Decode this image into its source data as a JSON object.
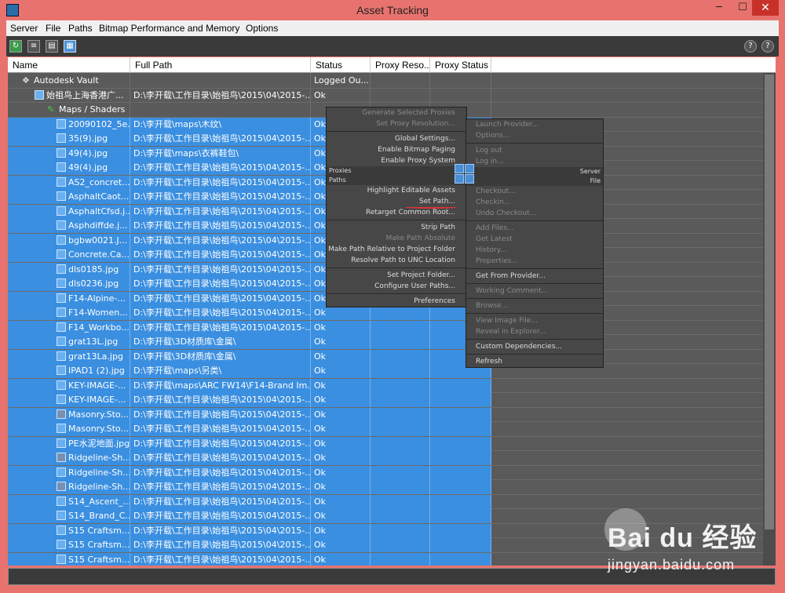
{
  "window": {
    "title": "Asset Tracking"
  },
  "menu": [
    "Server",
    "File",
    "Paths",
    "Bitmap Performance and Memory",
    "Options"
  ],
  "columns": [
    "Name",
    "Full Path",
    "Status",
    "Proxy Reso...",
    "Proxy Status"
  ],
  "rows": [
    {
      "name": "Autodesk Vault",
      "path": "",
      "status": "Logged Ou...",
      "icon": "vault-icon",
      "indent": 18,
      "sel": false
    },
    {
      "name": "始祖鸟上海香港广...",
      "path": "D:\\李开载\\工作目录\\始祖鸟\\2015\\04\\2015-...",
      "status": "Ok",
      "icon": "scene-icon",
      "indent": 34,
      "sel": false
    },
    {
      "name": "Maps / Shaders",
      "path": "",
      "status": "",
      "icon": "maps-icon",
      "indent": 50,
      "sel": false
    },
    {
      "name": "20090102_5e...",
      "path": "D:\\李开载\\maps\\木纹\\",
      "status": "Ok",
      "icon": "bitmap-icon",
      "indent": 62,
      "sel": true
    },
    {
      "name": "35(9).jpg",
      "path": "D:\\李开载\\工作目录\\始祖鸟\\2015\\04\\2015-...",
      "status": "Ok",
      "icon": "bitmap-icon",
      "indent": 62,
      "sel": true
    },
    {
      "name": "49(4).jpg",
      "path": "D:\\李开载\\maps\\衣裤鞋包\\",
      "status": "Ok",
      "icon": "bitmap-icon",
      "indent": 62,
      "sel": true
    },
    {
      "name": "49(4).jpg",
      "path": "D:\\李开载\\工作目录\\始祖鸟\\2015\\04\\2015-...",
      "status": "Ok",
      "icon": "bitmap-icon",
      "indent": 62,
      "sel": true
    },
    {
      "name": "AS2_concret...",
      "path": "D:\\李开载\\工作目录\\始祖鸟\\2015\\04\\2015-...",
      "status": "Ok",
      "icon": "bitmap-icon",
      "indent": 62,
      "sel": true
    },
    {
      "name": "AsphaltCaot...",
      "path": "D:\\李开载\\工作目录\\始祖鸟\\2015\\04\\2015-...",
      "status": "Ok",
      "icon": "bitmap-icon",
      "indent": 62,
      "sel": true
    },
    {
      "name": "AsphaltCfsd.j...",
      "path": "D:\\李开载\\工作目录\\始祖鸟\\2015\\04\\2015-...",
      "status": "Ok",
      "icon": "bitmap-icon",
      "indent": 62,
      "sel": true
    },
    {
      "name": "Asphdiffde.j...",
      "path": "D:\\李开载\\工作目录\\始祖鸟\\2015\\04\\2015-...",
      "status": "Ok",
      "icon": "bitmap-icon",
      "indent": 62,
      "sel": true
    },
    {
      "name": "bgbw0021.J...",
      "path": "D:\\李开载\\工作目录\\始祖鸟\\2015\\04\\2015-...",
      "status": "Ok",
      "icon": "bitmap-icon",
      "indent": 62,
      "sel": true
    },
    {
      "name": "Concrete.Ca...",
      "path": "D:\\李开载\\工作目录\\始祖鸟\\2015\\04\\2015-...",
      "status": "Ok",
      "icon": "bitmap-icon",
      "indent": 62,
      "sel": true
    },
    {
      "name": "dls0185.jpg",
      "path": "D:\\李开载\\工作目录\\始祖鸟\\2015\\04\\2015-...",
      "status": "Ok",
      "icon": "bitmap-icon",
      "indent": 62,
      "sel": true
    },
    {
      "name": "dls0236.jpg",
      "path": "D:\\李开载\\工作目录\\始祖鸟\\2015\\04\\2015-...",
      "status": "Ok",
      "icon": "bitmap-icon",
      "indent": 62,
      "sel": true
    },
    {
      "name": "F14-Alpine-...",
      "path": "D:\\李开载\\工作目录\\始祖鸟\\2015\\04\\2015-...",
      "status": "Ok",
      "icon": "bitmap-icon",
      "indent": 62,
      "sel": true
    },
    {
      "name": "F14-Women...",
      "path": "D:\\李开载\\工作目录\\始祖鸟\\2015\\04\\2015-...",
      "status": "Ok",
      "icon": "bitmap-icon",
      "indent": 62,
      "sel": true
    },
    {
      "name": "F14_Workbo...",
      "path": "D:\\李开载\\工作目录\\始祖鸟\\2015\\04\\2015-...",
      "status": "Ok",
      "icon": "bitmap-icon",
      "indent": 62,
      "sel": true
    },
    {
      "name": "grat13L.jpg",
      "path": "D:\\李开载\\3D材质库\\金属\\",
      "status": "Ok",
      "icon": "bitmap-icon",
      "indent": 62,
      "sel": true
    },
    {
      "name": "grat13La.jpg",
      "path": "D:\\李开载\\3D材质库\\金属\\",
      "status": "Ok",
      "icon": "bitmap-icon",
      "indent": 62,
      "sel": true
    },
    {
      "name": "IPAD1 (2).jpg",
      "path": "D:\\李开载\\maps\\另类\\",
      "status": "Ok",
      "icon": "bitmap-icon",
      "indent": 62,
      "sel": true
    },
    {
      "name": "KEY-IMAGE-...",
      "path": "D:\\李开载\\maps\\ARC FW14\\F14-Brand Im...",
      "status": "Ok",
      "icon": "bitmap-icon",
      "indent": 62,
      "sel": true
    },
    {
      "name": "KEY-IMAGE-...",
      "path": "D:\\李开载\\工作目录\\始祖鸟\\2015\\04\\2015-...",
      "status": "Ok",
      "icon": "bitmap-icon",
      "indent": 62,
      "sel": true
    },
    {
      "name": "Masonry.Sto...",
      "path": "D:\\李开载\\工作目录\\始祖鸟\\2015\\04\\2015-...",
      "status": "Ok",
      "icon": "bitmap-alt-icon",
      "indent": 62,
      "sel": true
    },
    {
      "name": "Masonry.Sto...",
      "path": "D:\\李开载\\工作目录\\始祖鸟\\2015\\04\\2015-...",
      "status": "Ok",
      "icon": "bitmap-icon",
      "indent": 62,
      "sel": true
    },
    {
      "name": "PE水泥地面.jpg",
      "path": "D:\\李开载\\工作目录\\始祖鸟\\2015\\04\\2015-...",
      "status": "Ok",
      "icon": "bitmap-icon",
      "indent": 62,
      "sel": true
    },
    {
      "name": "Ridgeline-Sh...",
      "path": "D:\\李开载\\工作目录\\始祖鸟\\2015\\04\\2015-...",
      "status": "Ok",
      "icon": "bitmap-alt-icon",
      "indent": 62,
      "sel": true
    },
    {
      "name": "Ridgeline-Sh...",
      "path": "D:\\李开载\\工作目录\\始祖鸟\\2015\\04\\2015-...",
      "status": "Ok",
      "icon": "bitmap-icon",
      "indent": 62,
      "sel": true
    },
    {
      "name": "Ridgeline-Sh...",
      "path": "D:\\李开载\\工作目录\\始祖鸟\\2015\\04\\2015-...",
      "status": "Ok",
      "icon": "bitmap-alt-icon",
      "indent": 62,
      "sel": true
    },
    {
      "name": "S14_Ascent_...",
      "path": "D:\\李开载\\工作目录\\始祖鸟\\2015\\04\\2015-...",
      "status": "Ok",
      "icon": "bitmap-icon",
      "indent": 62,
      "sel": true
    },
    {
      "name": "S14_Brand_C...",
      "path": "D:\\李开载\\工作目录\\始祖鸟\\2015\\04\\2015-...",
      "status": "Ok",
      "icon": "bitmap-icon",
      "indent": 62,
      "sel": true
    },
    {
      "name": "S15 Craftsm...",
      "path": "D:\\李开载\\工作目录\\始祖鸟\\2015\\04\\2015-...",
      "status": "Ok",
      "icon": "bitmap-icon",
      "indent": 62,
      "sel": true
    },
    {
      "name": "S15 Craftsm...",
      "path": "D:\\李开载\\工作目录\\始祖鸟\\2015\\04\\2015-...",
      "status": "Ok",
      "icon": "bitmap-icon",
      "indent": 62,
      "sel": true
    },
    {
      "name": "S15 Craftsm...",
      "path": "D:\\李开载\\工作目录\\始祖鸟\\2015\\04\\2015-...",
      "status": "Ok",
      "icon": "bitmap-icon",
      "indent": 62,
      "sel": true
    }
  ],
  "context_menu": {
    "left": [
      {
        "label": "Generate Selected Proxies",
        "dim": true
      },
      {
        "label": "Set Proxy Resolution...",
        "dim": true
      },
      {
        "sep": true
      },
      {
        "label": "Global Settings...",
        "dim": false
      },
      {
        "label": "Enable Bitmap Paging",
        "dim": false
      },
      {
        "label": "Enable Proxy System",
        "dim": false
      }
    ],
    "proxies_label": "Proxies",
    "server_label": "Server",
    "paths_label": "Paths",
    "file_label": "File",
    "left2": [
      {
        "label": "Highlight Editable Assets",
        "dim": false
      },
      {
        "label": "Set Path...",
        "dim": false
      },
      {
        "label": "Retarget Common Root...",
        "dim": false
      },
      {
        "sep": true
      },
      {
        "label": "Strip Path",
        "dim": false
      },
      {
        "label": "Make Path Absolute",
        "dim": true
      },
      {
        "label": "Make Path Relative to Project Folder",
        "dim": false
      },
      {
        "label": "Resolve Path to UNC Location",
        "dim": false
      },
      {
        "sep": true
      },
      {
        "label": "Set Project Folder...",
        "dim": false
      },
      {
        "label": "Configure User Paths...",
        "dim": false
      },
      {
        "sep": true
      },
      {
        "label": "Preferences",
        "dim": false
      }
    ],
    "right_top": [
      {
        "label": "Launch Provider...",
        "dim": true
      },
      {
        "label": "Options...",
        "dim": true
      },
      {
        "sep": true
      },
      {
        "label": "Log out",
        "dim": true
      },
      {
        "label": "Log in...",
        "dim": true
      }
    ],
    "right": [
      {
        "label": "Checkout...",
        "dim": true
      },
      {
        "label": "Checkin...",
        "dim": true
      },
      {
        "label": "Undo Checkout...",
        "dim": true
      },
      {
        "sep": true
      },
      {
        "label": "Add Files...",
        "dim": true
      },
      {
        "label": "Get Latest",
        "dim": true
      },
      {
        "label": "History...",
        "dim": true
      },
      {
        "label": "Properties...",
        "dim": true
      },
      {
        "sep": true
      },
      {
        "label": "Get From Provider...",
        "dim": false
      },
      {
        "sep": true
      },
      {
        "label": "Working Comment...",
        "dim": true
      },
      {
        "sep": true
      },
      {
        "label": "Browse...",
        "dim": true
      },
      {
        "sep": true
      },
      {
        "label": "View Image File...",
        "dim": true
      },
      {
        "label": "Reveal in Explorer...",
        "dim": true
      },
      {
        "sep": true
      },
      {
        "label": "Custom Dependencies...",
        "dim": false
      },
      {
        "sep": true
      },
      {
        "label": "Refresh",
        "dim": false
      }
    ]
  },
  "watermark": {
    "brand": "Bai du 经验",
    "site": "jingyan.baidu.com"
  }
}
